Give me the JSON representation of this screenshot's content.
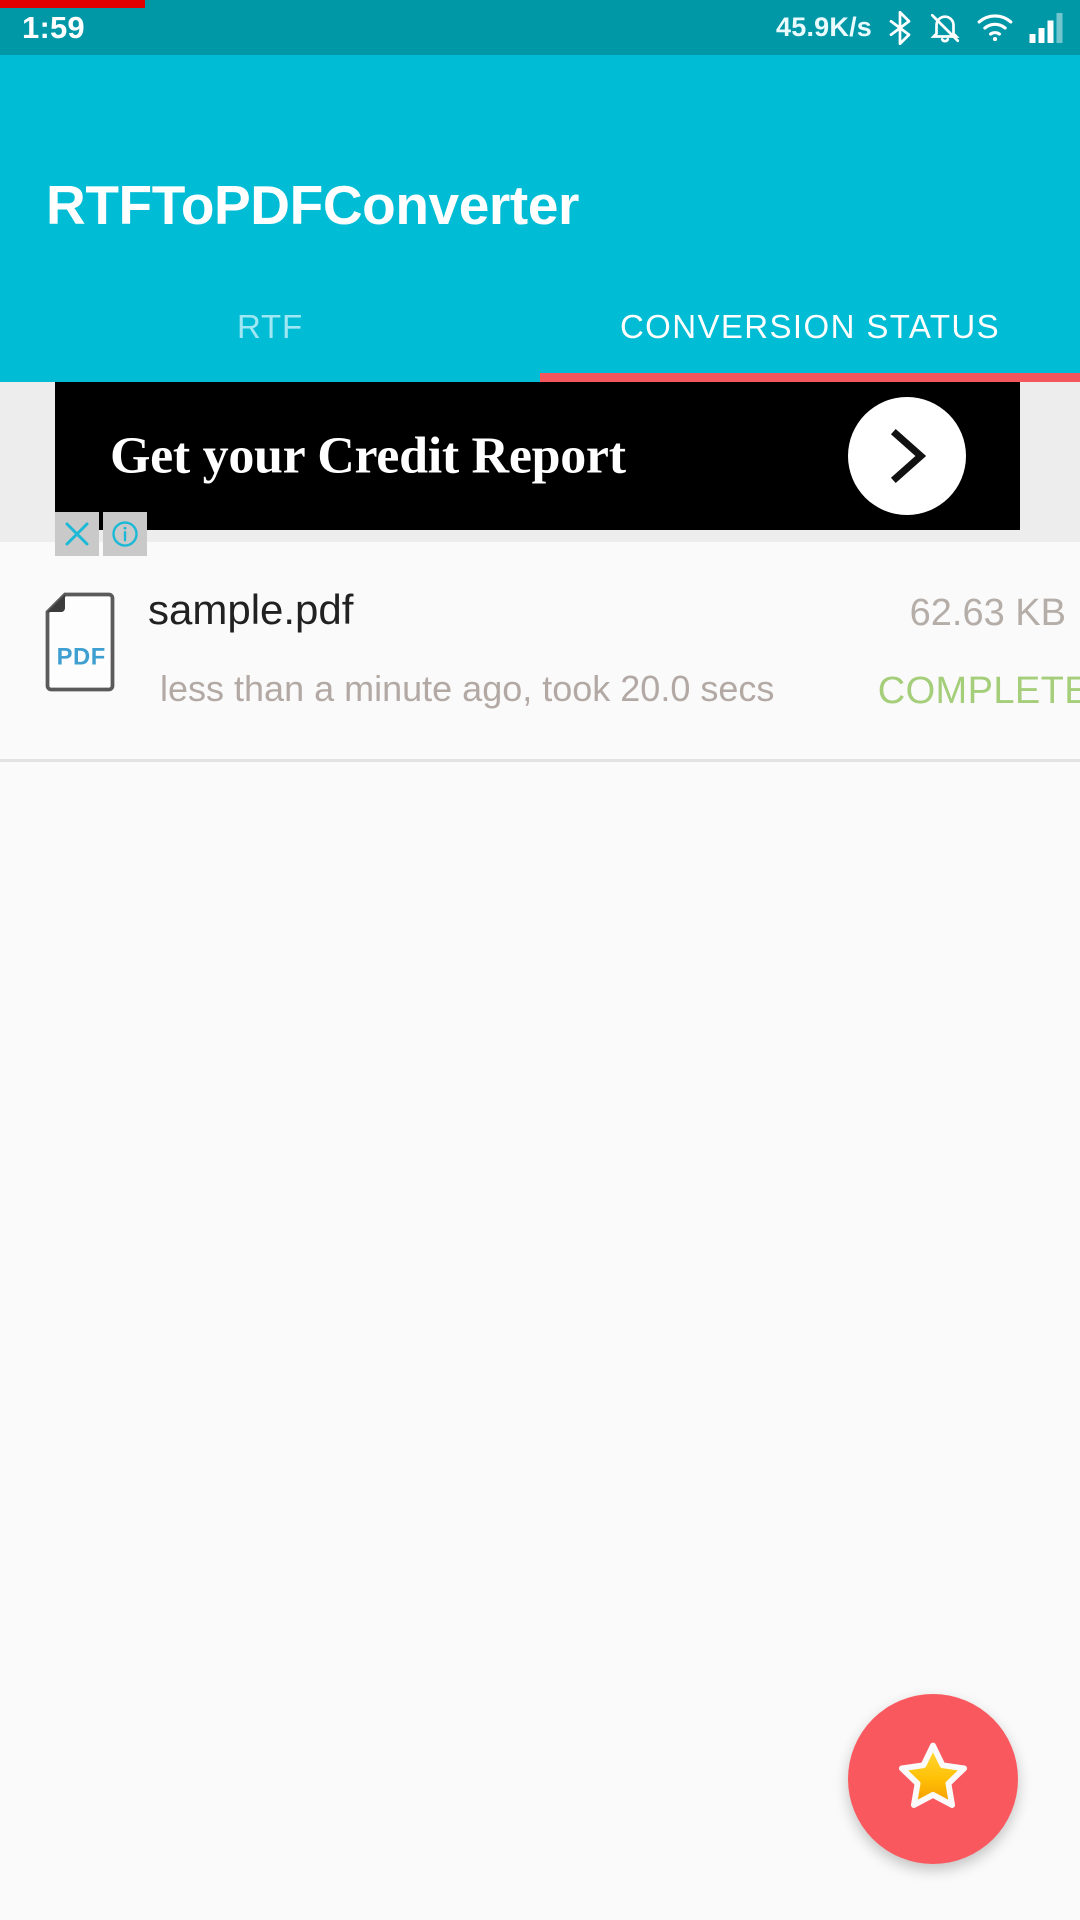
{
  "status_bar": {
    "time": "1:59",
    "network_speed": "45.9K/s",
    "icons": [
      "bluetooth-icon",
      "mute-bell-icon",
      "wifi-icon",
      "cellular-signal-icon"
    ],
    "background_color": "#0097A7",
    "progress_color": "#E00000"
  },
  "app_bar": {
    "title": "RTFToPDFConverter",
    "background_color": "#00BCD4",
    "indicator_color": "#F4565B",
    "tabs": [
      {
        "label": "RTF",
        "active": false
      },
      {
        "label": "CONVERSION STATUS",
        "active": true
      }
    ]
  },
  "ad": {
    "headline": "Get your Credit Report",
    "arrow_icon": "chevron-right-icon",
    "close_icon": "close-icon",
    "info_icon": "info-icon",
    "background_color": "#000000"
  },
  "conversion_list": {
    "items": [
      {
        "file_icon": "pdf-file-icon",
        "file_name": "sample.pdf",
        "subtitle": "less than a minute ago, took 20.0 secs",
        "size": "62.63 KB",
        "status": "COMPLETE",
        "status_color": "#A5CE7A"
      }
    ]
  },
  "fab": {
    "icon": "star-icon",
    "background_color": "#F9595E"
  }
}
